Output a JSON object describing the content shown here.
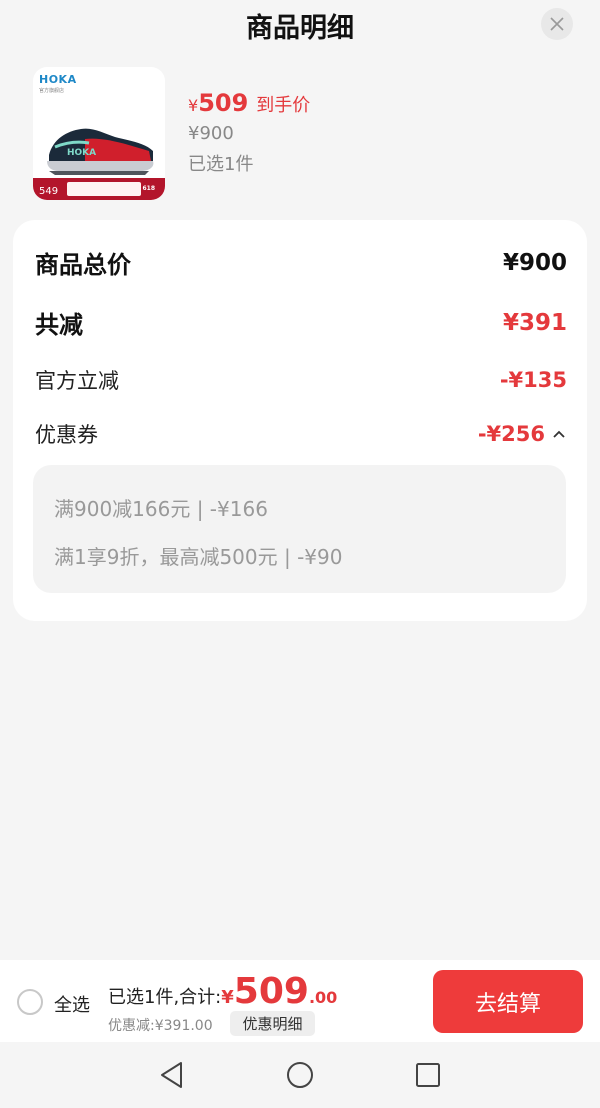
{
  "header": {
    "title": "商品明细",
    "close_icon": "close-icon"
  },
  "product": {
    "thumbnail": {
      "brand_text": "HOKA",
      "store_text": "官方旗舰店",
      "banner_price": "549",
      "banner_event": "618"
    },
    "price_symbol": "¥",
    "price": "509",
    "price_tag": "到手价",
    "original_price": "¥900",
    "selected_count": "已选1件"
  },
  "summary": {
    "total_label": "商品总价",
    "total_value": "¥900",
    "reduce_label": "共减",
    "reduce_value": "¥391",
    "official_label": "官方立减",
    "official_value": "-¥135",
    "coupon_label": "优惠券",
    "coupon_value": "-¥256",
    "coupon_expand_icon": "chevron-up-icon",
    "coupons": [
      "满900减166元 | -¥166",
      "满1享9折，最高减500元 | -¥90"
    ]
  },
  "bottom_bar": {
    "select_all_label": "全选",
    "sum_label": "已选1件,合计:",
    "sum_symbol": "¥",
    "sum_integer": "509",
    "sum_decimal": ".00",
    "discount_text": "优惠减:¥391.00",
    "detail_button": "优惠明细",
    "checkout_button": "去结算"
  },
  "colors": {
    "accent_red": "#e4393c",
    "checkout_red": "#ee3b3b",
    "background": "#f5f5f5"
  },
  "nav": {
    "back_icon": "back-triangle-icon",
    "home_icon": "home-circle-icon",
    "recent_icon": "recent-square-icon"
  }
}
